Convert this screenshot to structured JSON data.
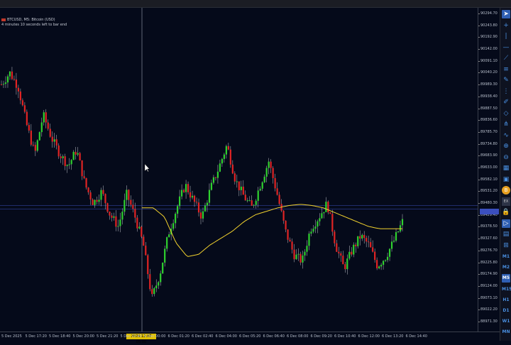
{
  "symbol": {
    "title": "BTCUSD, M5: Bitcoin (USD)",
    "countdown": "4 minutes 10 seconds left to bar end"
  },
  "price_scale": {
    "labels": [
      "90294.70",
      "90243.80",
      "90192.90",
      "90142.00",
      "90091.10",
      "90040.20",
      "89989.30",
      "89938.40",
      "89887.50",
      "89836.60",
      "89785.70",
      "89734.80",
      "89683.90",
      "89633.00",
      "89582.10",
      "89531.20",
      "89480.30",
      "89429.40",
      "89378.50",
      "89327.60",
      "89276.70",
      "89225.80",
      "89174.90",
      "89124.00",
      "89073.10",
      "89022.20",
      "88971.30"
    ],
    "current_price": ""
  },
  "time_axis": {
    "labels": [
      "5 Dec 2025",
      "5 Dec 17:20",
      "5 Dec 18:40",
      "5 Dec 20:00",
      "5 Dec 21:20",
      "5 Dec 22:40",
      "6 Dec 00:00",
      "6 Dec 01:20",
      "6 Dec 02:40",
      "6 Dec 04:00",
      "6 Dec 05:20",
      "6 Dec 06:40",
      "6 Dec 08:00",
      "6 Dec 09:20",
      "6 Dec 10:40",
      "6 Dec 12:00",
      "6 Dec 13:20",
      "6 Dec 14:40"
    ],
    "highlight": "2025.12.07 05:00"
  },
  "chart_data": {
    "type": "candlestick",
    "symbol": "BTCUSD",
    "timeframe": "M5",
    "ylim": [
      88971.3,
      90294.7
    ],
    "up_color": "#2fd12f",
    "down_color": "#e02424",
    "ma_color": "#f2d22e",
    "price_path_hint": [
      89990,
      90040,
      89980,
      89820,
      89690,
      89860,
      89760,
      89690,
      89640,
      89710,
      89560,
      89480,
      89530,
      89430,
      89380,
      89520,
      89420,
      89300,
      89070,
      89180,
      89350,
      89460,
      89560,
      89490,
      89420,
      89540,
      89630,
      89730,
      89580,
      89510,
      89460,
      89560,
      89660,
      89520,
      89360,
      89260,
      89230,
      89370,
      89420,
      89480,
      89300,
      89200,
      89280,
      89340,
      89300,
      89210,
      89250,
      89320,
      89400
    ],
    "ma_hint": [
      89460,
      89460,
      89420,
      89310,
      89250,
      89260,
      89300,
      89330,
      89360,
      89400,
      89430,
      89445,
      89460,
      89470,
      89475,
      89470,
      89460,
      89440,
      89420,
      89400,
      89380,
      89370,
      89370,
      89370
    ]
  },
  "toolbar": {
    "timeframes": [
      "M1",
      "M2",
      "M5",
      "M15",
      "H1",
      "D1",
      "W1",
      "MN"
    ],
    "active_timeframe": "M5",
    "ex_label": "EX",
    "icons": [
      "cursor-icon",
      "crosshair-icon",
      "vertical-line-icon",
      "horizontal-line-icon",
      "trend-line-icon",
      "channel-icon",
      "pencil-icon",
      "fibonacci-icon",
      "brush-icon",
      "shapes-icon",
      "pitchfork-icon",
      "indicators-icon",
      "zoom-in-icon",
      "zoom-out-icon",
      "grid-icon",
      "screenshot-icon",
      "bitcoin-icon",
      "ex-icon",
      "lock-icon",
      "play-icon",
      "chart-icon",
      "layout-icon"
    ]
  }
}
